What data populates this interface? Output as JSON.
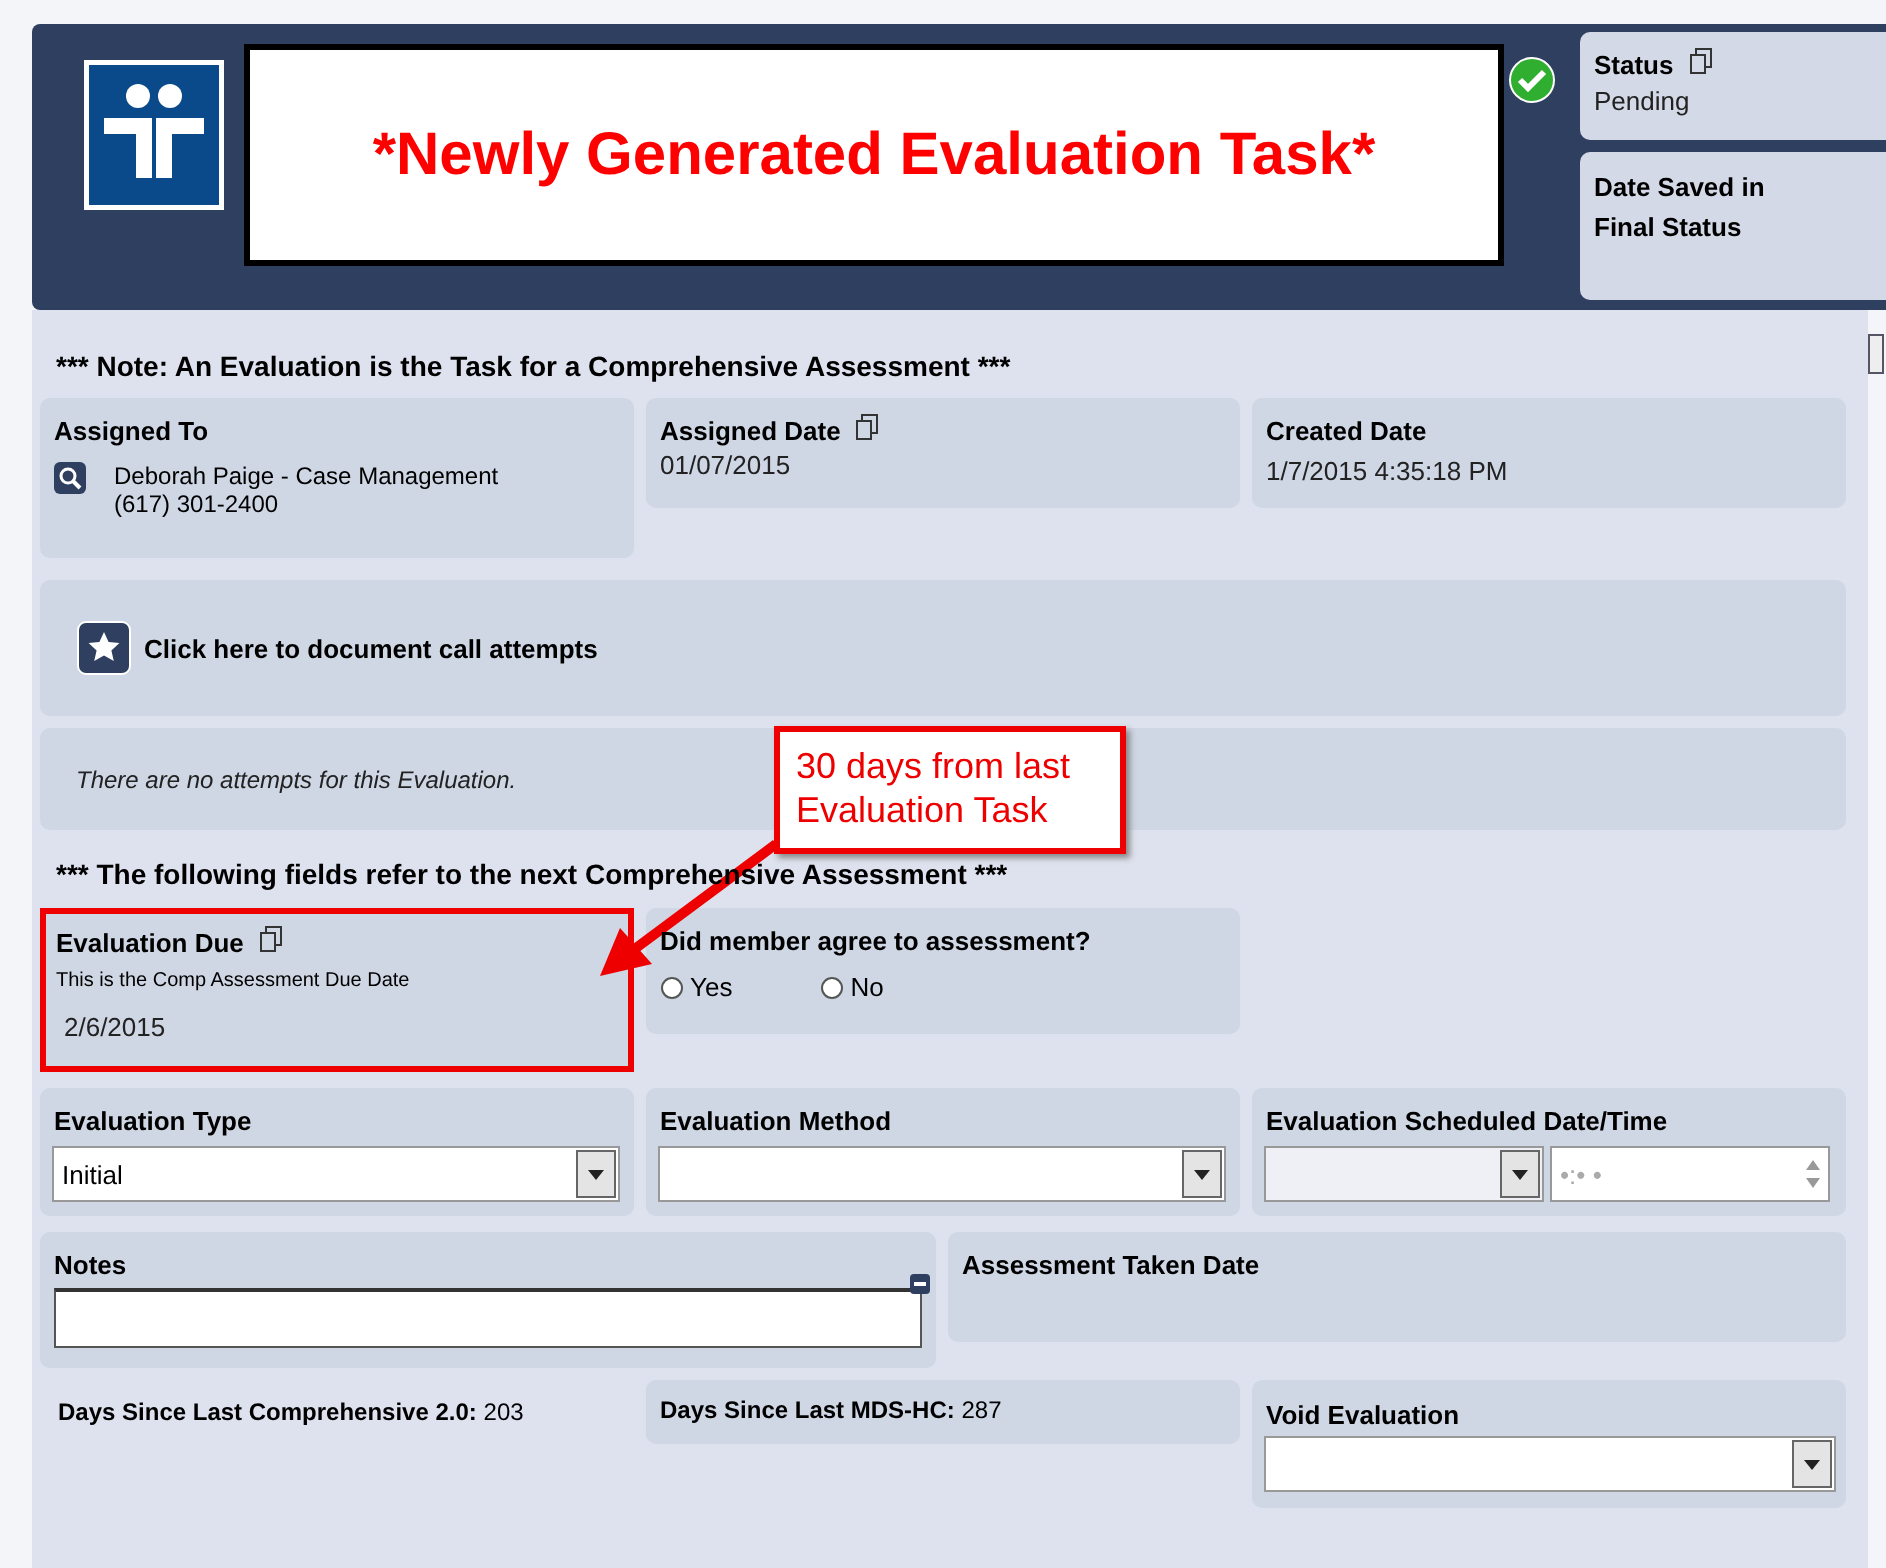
{
  "header": {
    "banner": "*Newly Generated Evaluation Task*",
    "status": {
      "label": "Status",
      "value": "Pending"
    },
    "date_saved": {
      "label": "Date Saved in Final Status"
    }
  },
  "note_heading": "*** Note: An Evaluation is the Task for a Comprehensive Assessment ***",
  "assigned_to": {
    "label": "Assigned To",
    "name": "Deborah Paige - Case Management",
    "phone": "(617) 301-2400"
  },
  "assigned_date": {
    "label": "Assigned Date",
    "value": "01/07/2015"
  },
  "created_date": {
    "label": "Created Date",
    "value": "1/7/2015 4:35:18 PM"
  },
  "call_attempts": {
    "link": "Click here to document call attempts",
    "empty_message": "There are no attempts for this Evaluation."
  },
  "callout": "30 days from last Evaluation Task",
  "fields_heading": "*** The following fields refer to the next Comprehensive Assessment ***",
  "evaluation_due": {
    "label": "Evaluation Due",
    "hint": "This is the Comp Assessment Due Date",
    "value": "2/6/2015",
    "highlighted": true
  },
  "agreement": {
    "label": "Did member agree to assessment?",
    "options": [
      {
        "label": "Yes",
        "selected": false
      },
      {
        "label": "No",
        "selected": false
      }
    ]
  },
  "evaluation_type": {
    "label": "Evaluation Type",
    "value": "Initial"
  },
  "evaluation_method": {
    "label": "Evaluation Method"
  },
  "scheduled": {
    "label": "Evaluation Scheduled Date/Time",
    "time_placeholder": "•:• •"
  },
  "notes": {
    "label": "Notes"
  },
  "assessment_taken": {
    "label": "Assessment Taken Date"
  },
  "days_comprehensive": {
    "label": "Days Since Last Comprehensive 2.0:",
    "value": "203"
  },
  "days_mds": {
    "label": "Days Since Last MDS-HC:",
    "value": "287"
  },
  "void": {
    "label": "Void Evaluation"
  }
}
